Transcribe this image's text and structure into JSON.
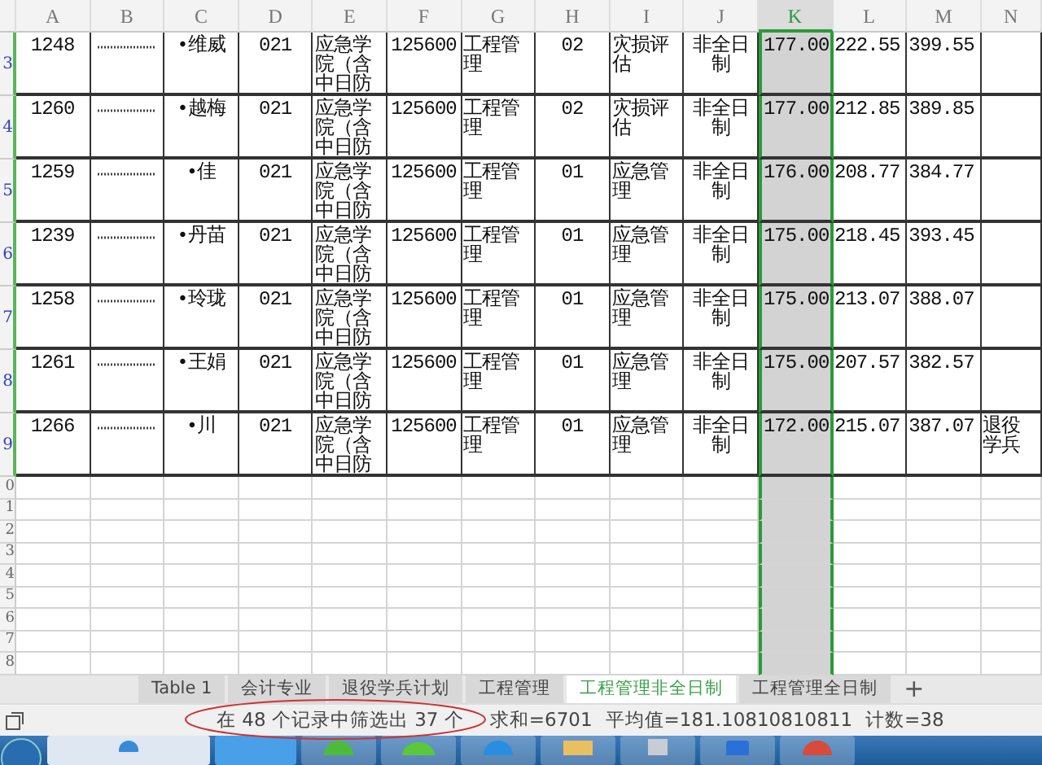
{
  "columns": [
    {
      "label": "A",
      "selected": false
    },
    {
      "label": "B",
      "selected": false
    },
    {
      "label": "C",
      "selected": false
    },
    {
      "label": "D",
      "selected": false
    },
    {
      "label": "E",
      "selected": false
    },
    {
      "label": "F",
      "selected": false
    },
    {
      "label": "G",
      "selected": false
    },
    {
      "label": "H",
      "selected": false
    },
    {
      "label": "I",
      "selected": false
    },
    {
      "label": "J",
      "selected": false
    },
    {
      "label": "K",
      "selected": true
    },
    {
      "label": "L",
      "selected": false
    },
    {
      "label": "M",
      "selected": false
    },
    {
      "label": "N",
      "selected": false
    }
  ],
  "rows": [
    {
      "header": "3",
      "cells": [
        "1248",
        null,
        "•维威",
        "021",
        "应急学院（含中日防",
        "125600",
        "工程管理",
        "02",
        "灾损评估",
        "非全日制",
        "177.00",
        "222.55",
        "399.55",
        null
      ]
    },
    {
      "header": "4",
      "cells": [
        "1260",
        null,
        "•越梅",
        "021",
        "应急学院（含中日防",
        "125600",
        "工程管理",
        "02",
        "灾损评估",
        "非全日制",
        "177.00",
        "212.85",
        "389.85",
        null
      ]
    },
    {
      "header": "5",
      "cells": [
        "1259",
        null,
        "•佳",
        "021",
        "应急学院（含中日防",
        "125600",
        "工程管理",
        "01",
        "应急管理",
        "非全日制",
        "176.00",
        "208.77",
        "384.77",
        null
      ]
    },
    {
      "header": "6",
      "cells": [
        "1239",
        null,
        "•丹苗",
        "021",
        "应急学院（含中日防",
        "125600",
        "工程管理",
        "01",
        "应急管理",
        "非全日制",
        "175.00",
        "218.45",
        "393.45",
        null
      ]
    },
    {
      "header": "7",
      "cells": [
        "1258",
        null,
        "•玲珑",
        "021",
        "应急学院（含中日防",
        "125600",
        "工程管理",
        "01",
        "应急管理",
        "非全日制",
        "175.00",
        "213.07",
        "388.07",
        null
      ]
    },
    {
      "header": "8",
      "cells": [
        "1261",
        null,
        "•王娟",
        "021",
        "应急学院（含中日防",
        "125600",
        "工程管理",
        "01",
        "应急管理",
        "非全日制",
        "175.00",
        "207.57",
        "382.57",
        null
      ]
    },
    {
      "header": "9",
      "cells": [
        "1266",
        null,
        "•川",
        "021",
        "应急学院（含中日防",
        "125600",
        "工程管理",
        "01",
        "应急管理",
        "非全日制",
        "172.00",
        "215.07",
        "387.07",
        "退役学兵"
      ]
    }
  ],
  "empty_rows": [
    "0",
    "1",
    "2",
    "3",
    "4",
    "5",
    "6",
    "7",
    "8"
  ],
  "sheet_tabs": [
    {
      "label": "Table 1",
      "selected": false
    },
    {
      "label": "会计专业",
      "selected": false
    },
    {
      "label": "退役学兵计划",
      "selected": false
    },
    {
      "label": "工程管理",
      "selected": false
    },
    {
      "label": "工程管理非全日制",
      "selected": true
    },
    {
      "label": "工程管理全日制",
      "selected": false
    }
  ],
  "add_tab": "+",
  "status_bar": {
    "filter_message": "在 48 个记录中筛选出 37 个",
    "sum": "求和=6701",
    "average": "平均值=181.10810810811",
    "count": "计数=38"
  }
}
